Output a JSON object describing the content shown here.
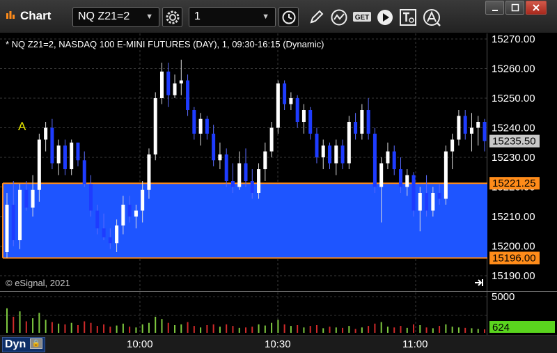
{
  "window": {
    "title": "Chart"
  },
  "toolbar": {
    "symbol": "NQ Z21=2",
    "interval": "1",
    "icons": [
      "gear-icon",
      "clock-icon",
      "pencil-icon",
      "study-icon",
      "get-icon",
      "play-icon",
      "text-icon",
      "alert-icon"
    ],
    "get_label": "GET"
  },
  "chart": {
    "header": "* NQ Z21=2, NASDAQ 100 E-MINI FUTURES (DAY), 1, 09:30-16:15 (Dynamic)",
    "copyright": "© eSignal, 2021",
    "annotation": "A",
    "price_labels": [
      "15270.00",
      "15260.00",
      "15250.00",
      "15240.00",
      "15230.00",
      "15220.00",
      "15210.00",
      "15200.00",
      "15190.00"
    ],
    "badges": {
      "last_price": "15235.50",
      "upper_line": "15221.25",
      "lower_line": "15196.00",
      "volume_last": "624"
    },
    "volume_axis_label": "5000",
    "colors": {
      "zone_fill": "#1e55ff",
      "line": "#ff8c1a",
      "up": "#ffffff",
      "down": "#1e3cff",
      "vol_up": "#7fc93f",
      "vol_down": "#d02a2a",
      "annotation": "#e8e800",
      "last_badge": "#c8c8c8",
      "volume_badge": "#5ad41e"
    }
  },
  "chart_data": {
    "type": "candlestick",
    "price_range": [
      15185,
      15275
    ],
    "zone": [
      15196.0,
      15221.25
    ],
    "last_price": 15235.5,
    "time_ticks": [
      "10:00",
      "10:30",
      "11:00"
    ],
    "bars": [
      [
        15198,
        15218,
        15196,
        15214
      ],
      [
        15214,
        15222,
        15200,
        15202
      ],
      [
        15202,
        15221,
        15199,
        15219
      ],
      [
        15219,
        15222,
        15212,
        15213
      ],
      [
        15213,
        15224,
        15210,
        15219
      ],
      [
        15219,
        15238,
        15215,
        15236
      ],
      [
        15236,
        15242,
        15232,
        15240
      ],
      [
        15240,
        15243,
        15226,
        15228
      ],
      [
        15228,
        15236,
        15224,
        15234
      ],
      [
        15234,
        15236,
        15224,
        15226
      ],
      [
        15226,
        15236,
        15224,
        15235
      ],
      [
        15235,
        15234,
        15227,
        15229
      ],
      [
        15229,
        15232,
        15220,
        15221
      ],
      [
        15221,
        15224,
        15210,
        15212
      ],
      [
        15212,
        15214,
        15204,
        15206
      ],
      [
        15206,
        15211,
        15202,
        15203
      ],
      [
        15203,
        15206,
        15199,
        15201
      ],
      [
        15201,
        15209,
        15198,
        15207
      ],
      [
        15207,
        15217,
        15204,
        15214
      ],
      [
        15214,
        15217,
        15208,
        15210
      ],
      [
        15210,
        15214,
        15206,
        15212
      ],
      [
        15212,
        15222,
        15208,
        15219
      ],
      [
        15219,
        15233,
        15216,
        15231
      ],
      [
        15231,
        15252,
        15229,
        15250
      ],
      [
        15250,
        15262,
        15248,
        15259
      ],
      [
        15259,
        15262,
        15247,
        15251
      ],
      [
        15251,
        15258,
        15250,
        15255
      ],
      [
        15255,
        15263,
        15251,
        15256
      ],
      [
        15256,
        15258,
        15244,
        15246
      ],
      [
        15246,
        15247,
        15236,
        15238
      ],
      [
        15238,
        15245,
        15234,
        15243
      ],
      [
        15243,
        15244,
        15236,
        15238
      ],
      [
        15238,
        15241,
        15227,
        15229
      ],
      [
        15229,
        15235,
        15226,
        15231
      ],
      [
        15231,
        15233,
        15220,
        15222
      ],
      [
        15222,
        15228,
        15218,
        15220
      ],
      [
        15220,
        15232,
        15219,
        15228
      ],
      [
        15228,
        15233,
        15220,
        15222
      ],
      [
        15222,
        15226,
        15216,
        15218
      ],
      [
        15218,
        15228,
        15216,
        15226
      ],
      [
        15226,
        15235,
        15222,
        15232
      ],
      [
        15232,
        15242,
        15230,
        15240
      ],
      [
        15240,
        15256,
        15238,
        15255
      ],
      [
        15255,
        15256,
        15246,
        15248
      ],
      [
        15248,
        15252,
        15246,
        15250
      ],
      [
        15250,
        15251,
        15240,
        15242
      ],
      [
        15242,
        15248,
        15238,
        15246
      ],
      [
        15246,
        15247,
        15236,
        15238
      ],
      [
        15238,
        15240,
        15228,
        15230
      ],
      [
        15230,
        15236,
        15226,
        15234
      ],
      [
        15234,
        15235,
        15226,
        15228
      ],
      [
        15228,
        15236,
        15224,
        15234
      ],
      [
        15234,
        15236,
        15226,
        15228
      ],
      [
        15228,
        15244,
        15226,
        15242
      ],
      [
        15242,
        15245,
        15236,
        15238
      ],
      [
        15238,
        15248,
        15236,
        15246
      ],
      [
        15246,
        15250,
        15236,
        15238
      ],
      [
        15238,
        15240,
        15218,
        15220
      ],
      [
        15220,
        15230,
        15208,
        15228
      ],
      [
        15228,
        15235,
        15226,
        15232
      ],
      [
        15232,
        15234,
        15224,
        15226
      ],
      [
        15226,
        15230,
        15218,
        15220
      ],
      [
        15220,
        15226,
        15217,
        15224
      ],
      [
        15224,
        15225,
        15210,
        15212
      ],
      [
        15212,
        15220,
        15205,
        15218
      ],
      [
        15218,
        15224,
        15210,
        15212
      ],
      [
        15212,
        15220,
        15210,
        15218
      ],
      [
        15218,
        15221,
        15214,
        15216
      ],
      [
        15216,
        15234,
        15214,
        15232
      ],
      [
        15232,
        15238,
        15226,
        15236
      ],
      [
        15236,
        15246,
        15234,
        15244
      ],
      [
        15244,
        15246,
        15236,
        15238
      ],
      [
        15238,
        15245,
        15232,
        15240
      ],
      [
        15240,
        15244,
        15234,
        15242
      ],
      [
        15242,
        15243,
        15232,
        15235.5
      ]
    ],
    "volumes": [
      3200,
      2100,
      2800,
      1500,
      1900,
      2600,
      1700,
      1400,
      1200,
      1100,
      1300,
      1000,
      1500,
      1300,
      900,
      1100,
      800,
      950,
      1200,
      800,
      700,
      1100,
      1300,
      2100,
      1800,
      1300,
      1000,
      1100,
      1400,
      900,
      700,
      1000,
      1100,
      800,
      1100,
      900,
      650,
      700,
      800,
      1100,
      950,
      1300,
      1700,
      1100,
      900,
      1000,
      700,
      900,
      1000,
      600,
      800,
      700,
      650,
      900,
      500,
      700,
      900,
      1200,
      1400,
      800,
      700,
      900,
      650,
      1100,
      1000,
      700,
      600,
      900,
      1100,
      800,
      700,
      650,
      600,
      500,
      450
    ]
  }
}
